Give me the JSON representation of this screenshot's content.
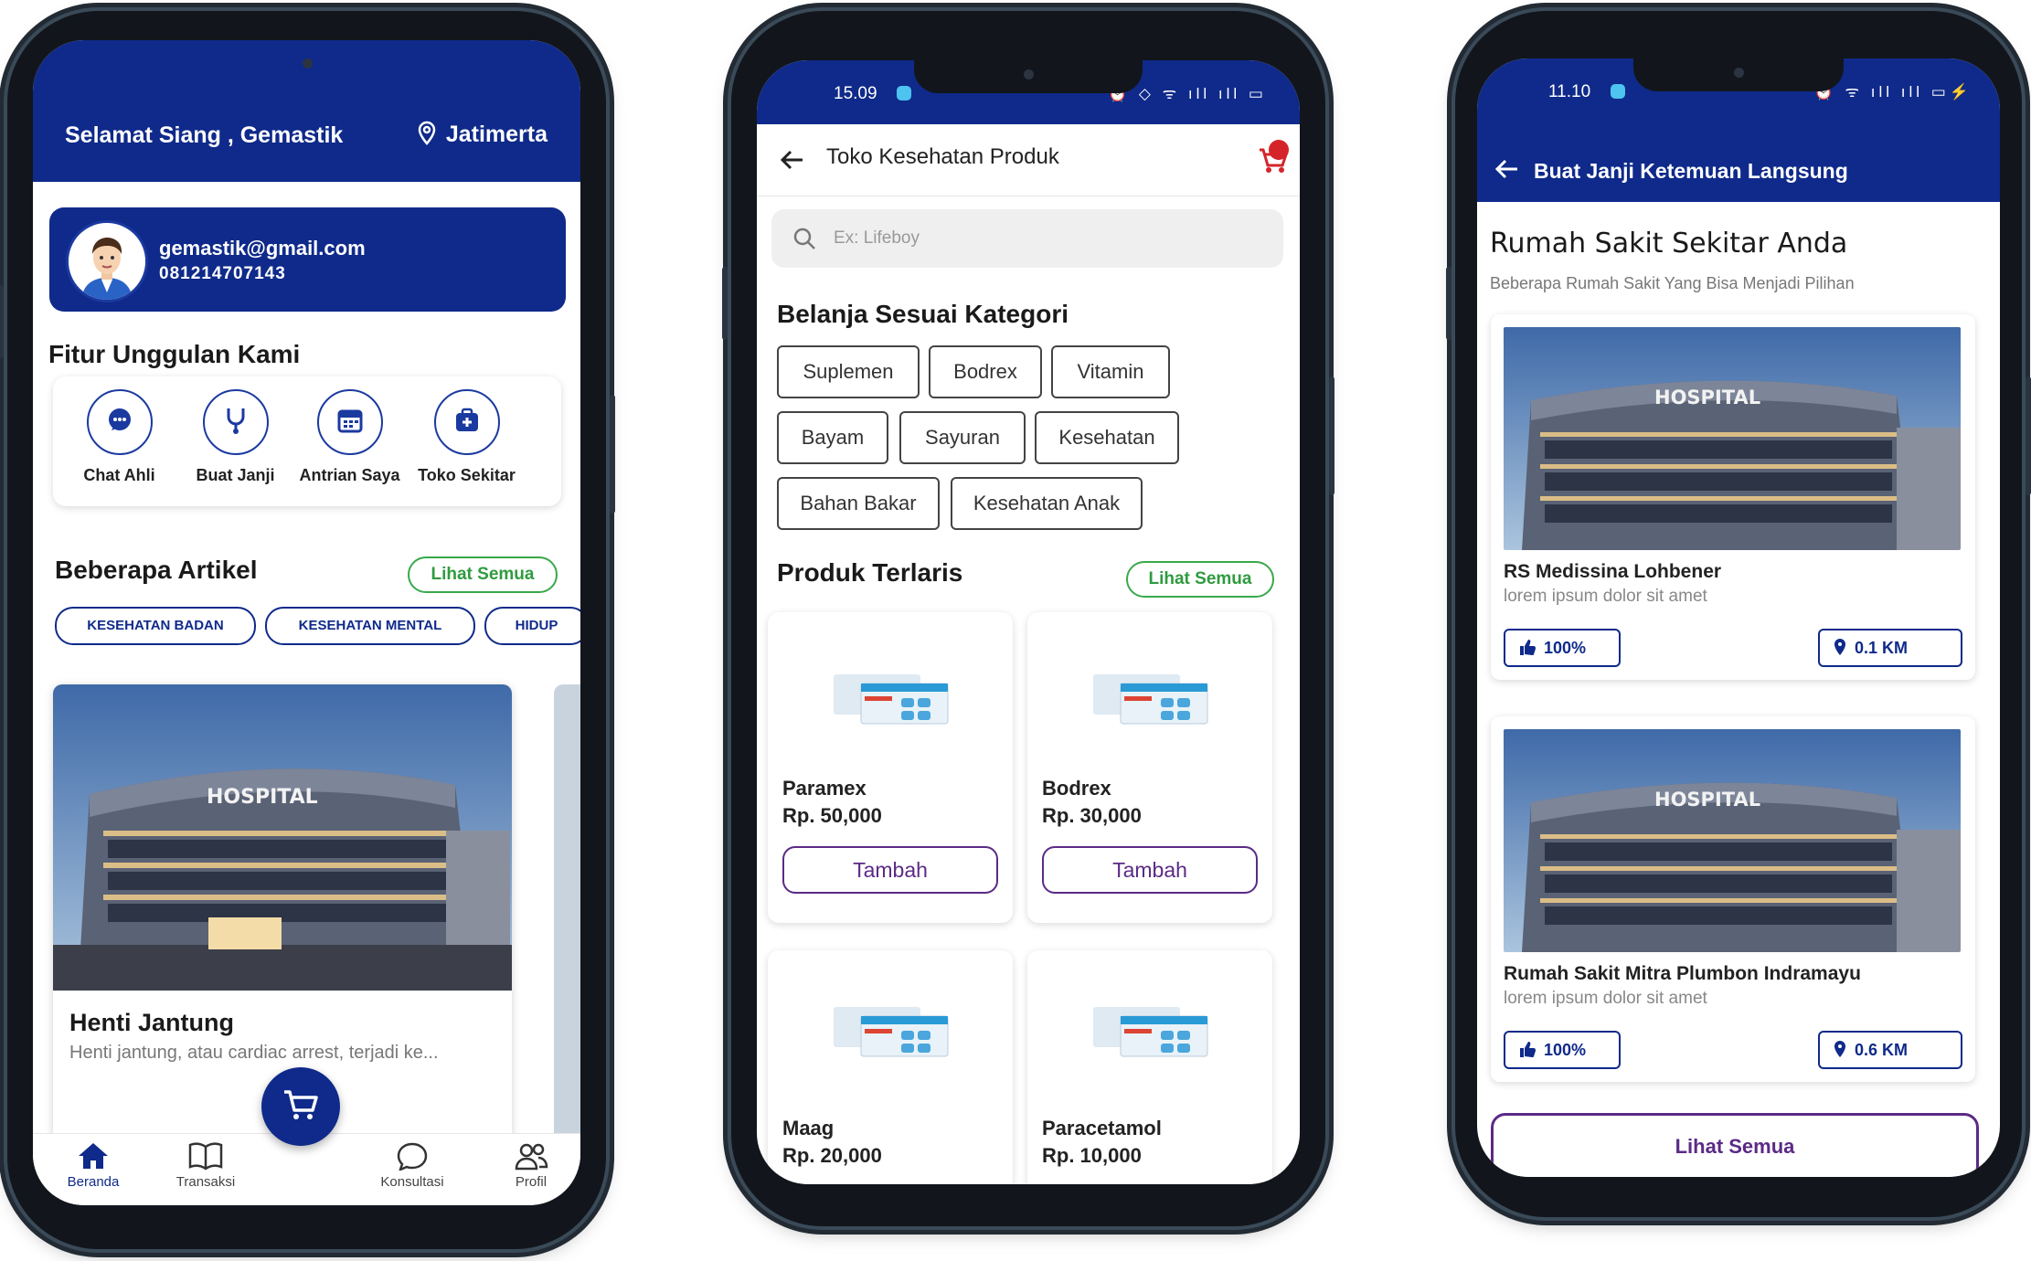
{
  "colors": {
    "primary": "#0f2a8a",
    "accent_green": "#2f9b3f",
    "button_purple": "#5b2a86"
  },
  "home": {
    "greeting": "Selamat Siang , Gemastik",
    "location": "Jatimerta",
    "user": {
      "email": "gemastik@gmail.com",
      "phone": "081214707143"
    },
    "features_title": "Fitur Unggulan Kami",
    "features": [
      {
        "label": "Chat Ahli",
        "icon": "chat-icon"
      },
      {
        "label": "Buat Janji",
        "icon": "stethoscope-icon"
      },
      {
        "label": "Antrian Saya",
        "icon": "calendar-icon"
      },
      {
        "label": "Toko Sekitar",
        "icon": "medkit-icon"
      }
    ],
    "articles_title": "Beberapa Artikel",
    "see_all": "Lihat Semua",
    "chips": [
      "KESEHATAN BADAN",
      "KESEHATAN MENTAL",
      "HIDUP"
    ],
    "article": {
      "image_text": "HOSPITAL",
      "title": "Henti Jantung",
      "desc": "Henti jantung, atau cardiac arrest, terjadi ke..."
    },
    "nav": [
      {
        "label": "Beranda",
        "icon": "home-icon"
      },
      {
        "label": "Transaksi",
        "icon": "book-icon"
      },
      {
        "label": "Konsultasi",
        "icon": "chat-bubble-icon"
      },
      {
        "label": "Profil",
        "icon": "users-icon"
      }
    ]
  },
  "shop": {
    "time": "15.09",
    "title": "Toko Kesehatan Produk",
    "search_placeholder": "Ex: Lifeboy",
    "categories_title": "Belanja Sesuai Kategori",
    "categories": [
      "Suplemen",
      "Bodrex",
      "Vitamin",
      "Bayam",
      "Sayuran",
      "Kesehatan",
      "Bahan Bakar",
      "Kesehatan Anak"
    ],
    "best_title": "Produk Terlaris",
    "see_all": "Lihat Semua",
    "add_label": "Tambah",
    "products": [
      {
        "name": "Paramex",
        "price": "Rp. 50,000"
      },
      {
        "name": "Bodrex",
        "price": "Rp. 30,000"
      },
      {
        "name": "Maag",
        "price": "Rp. 20,000"
      },
      {
        "name": "Paracetamol",
        "price": "Rp. 10,000"
      }
    ]
  },
  "appointment": {
    "time": "11.10",
    "title": "Buat Janji Ketemuan Langsung",
    "section_title": "Rumah Sakit Sekitar Anda",
    "section_sub": "Beberapa Rumah Sakit Yang Bisa Menjadi Pilihan",
    "hospitals": [
      {
        "image_text": "HOSPITAL",
        "name": "RS Medissina Lohbener",
        "desc": "lorem ipsum dolor sit amet",
        "rating": "100%",
        "distance": "0.1 KM"
      },
      {
        "image_text": "HOSPITAL",
        "name": "Rumah Sakit Mitra Plumbon Indramayu",
        "desc": "lorem ipsum dolor sit amet",
        "rating": "100%",
        "distance": "0.6 KM"
      }
    ],
    "see_all": "Lihat Semua"
  }
}
